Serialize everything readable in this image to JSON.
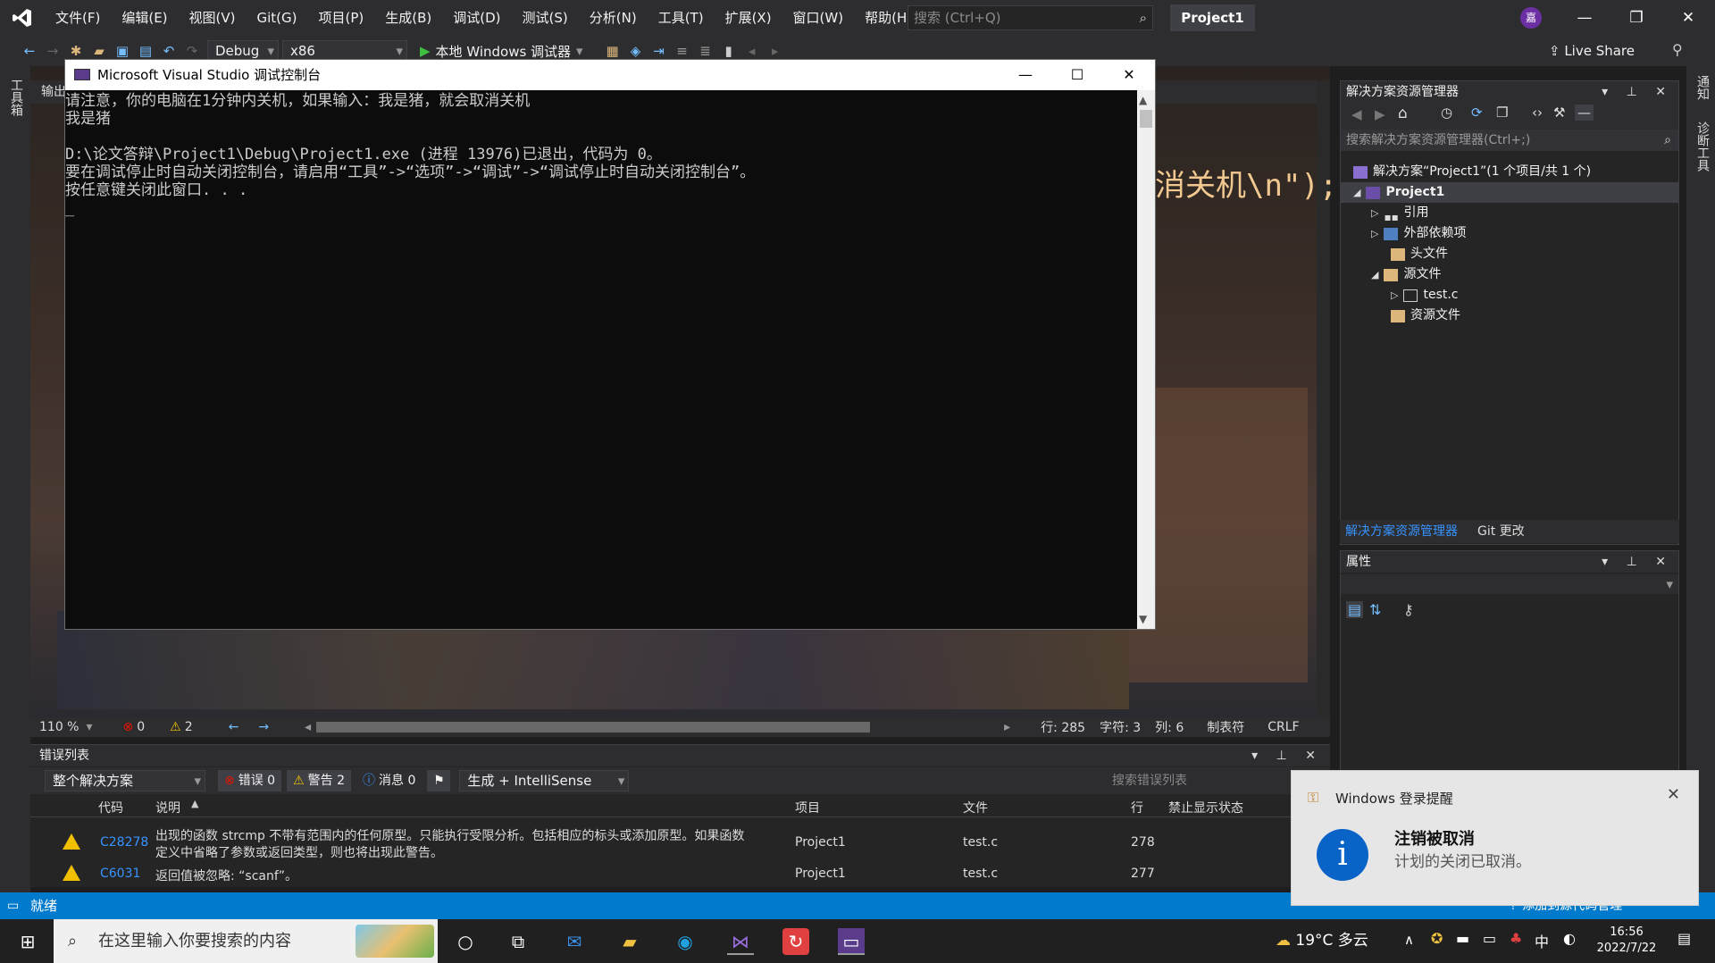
{
  "menubar": {
    "items": [
      "文件(F)",
      "编辑(E)",
      "视图(V)",
      "Git(G)",
      "项目(P)",
      "生成(B)",
      "调试(D)",
      "测试(S)",
      "分析(N)",
      "工具(T)",
      "扩展(X)",
      "窗口(W)",
      "帮助(H)"
    ],
    "search_placeholder": "搜索 (Ctrl+Q)",
    "project_name": "Project1",
    "avatar_initial": "嘉"
  },
  "toolbar": {
    "config": "Debug",
    "platform": "x86",
    "run_label": "本地 Windows 调试器",
    "live_share": "Live Share"
  },
  "left_tabs": [
    "工具箱"
  ],
  "right_tabs": [
    "通知",
    "诊断工具"
  ],
  "editor": {
    "tab_label": "输出",
    "code_fragment": "消关机\\n\");",
    "zoom": "110 %",
    "errors": "0",
    "warnings": "2",
    "line": "行: 285",
    "char": "字符: 3",
    "col": "列: 6",
    "indent": "制表符",
    "eol": "CRLF"
  },
  "console": {
    "title": "Microsoft Visual Studio 调试控制台",
    "lines": [
      "请注意，你的电脑在1分钟内关机，如果输入：我是猪，就会取消关机",
      "我是猪",
      "",
      "D:\\论文答辩\\Project1\\Debug\\Project1.exe (进程 13976)已退出，代码为 0。",
      "要在调试停止时自动关闭控制台，请启用“工具”->“选项”->“调试”->“调试停止时自动关闭控制台”。",
      "按任意键关闭此窗口. . .",
      "_"
    ]
  },
  "solution_explorer": {
    "title": "解决方案资源管理器",
    "search_placeholder": "搜索解决方案资源管理器(Ctrl+;)",
    "solution": "解决方案“Project1”(1 个项目/共 1 个)",
    "project": "Project1",
    "nodes": [
      "引用",
      "外部依赖项",
      "头文件",
      "源文件",
      "test.c",
      "资源文件"
    ],
    "tabs": [
      "解决方案资源管理器",
      "Git 更改"
    ]
  },
  "properties": {
    "title": "属性"
  },
  "error_list": {
    "title": "错误列表",
    "scope": "整个解决方案",
    "errors_btn": "错误 0",
    "warnings_btn": "警告 2",
    "messages_btn": "消息 0",
    "build_filter": "生成 + IntelliSense",
    "search_placeholder": "搜索错误列表",
    "columns": [
      "代码",
      "说明",
      "项目",
      "文件",
      "行",
      "禁止显示状态"
    ],
    "rows": [
      {
        "code": "C28278",
        "desc_line1": "出现的函数 strcmp 不带有范围内的任何原型。只能执行受限分析。包括相应的标头或添加原型。如果函数",
        "desc_line2": "定义中省略了参数或返回类型，则也将出现此警告。",
        "project": "Project1",
        "file": "test.c",
        "line": "278"
      },
      {
        "code": "C6031",
        "desc_line1": "返回值被忽略: “scanf”。",
        "desc_line2": "",
        "project": "Project1",
        "file": "test.c",
        "line": "277"
      }
    ]
  },
  "statusbar": {
    "state": "就绪",
    "source_control": "添加到源代码管理"
  },
  "taskbar": {
    "search_placeholder": "在这里输入你要搜索的内容",
    "weather": "19°C 多云",
    "ime": "中",
    "time": "16:56",
    "date": "2022/7/22"
  },
  "toast": {
    "app": "Windows 登录提醒",
    "title": "注销被取消",
    "message": "计划的关闭已取消。"
  },
  "colors": {
    "accent": "#007acc",
    "link": "#3794ff",
    "warning": "#f0c000",
    "error": "#e51400"
  }
}
